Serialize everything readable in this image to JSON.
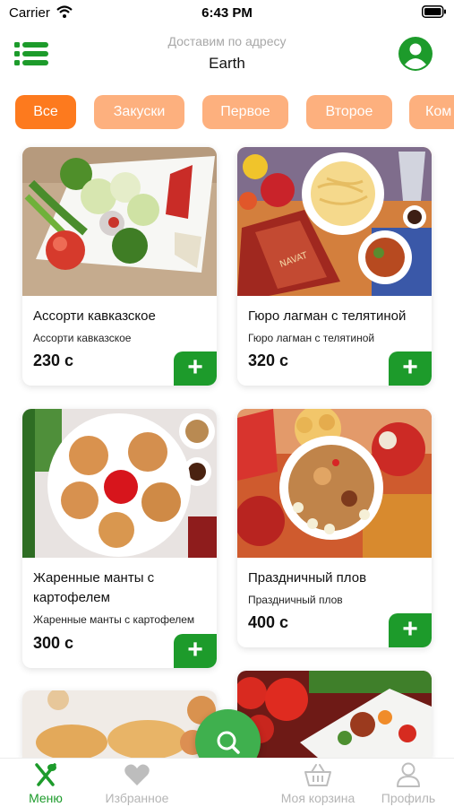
{
  "status_bar": {
    "carrier": "Carrier",
    "time": "6:43 PM"
  },
  "header": {
    "subtitle": "Доставим по адресу",
    "address": "Earth"
  },
  "categories": [
    {
      "label": "Все",
      "active": true
    },
    {
      "label": "Закуски",
      "active": false
    },
    {
      "label": "Первое",
      "active": false
    },
    {
      "label": "Второе",
      "active": false
    },
    {
      "label": "Ком",
      "active": false
    }
  ],
  "products": [
    {
      "title": "Ассорти кавказское",
      "description": "Ассорти кавказское",
      "price": "230 с",
      "add_label": "+"
    },
    {
      "title": "Гюро лагман с телятиной",
      "description": "Гюро лагман с телятиной",
      "price": "320 с",
      "add_label": "+"
    },
    {
      "title": "Жаренные манты с картофелем",
      "description": "Жаренные манты с картофелем",
      "price": "300 с",
      "add_label": "+"
    },
    {
      "title": "Праздничный плов",
      "description": "Праздничный плов",
      "price": "400 с",
      "add_label": "+"
    }
  ],
  "image_labels": {
    "navat": "NAVAT"
  },
  "tabbar": {
    "menu": "Меню",
    "favorites": "Избранное",
    "cart": "Моя корзина",
    "profile": "Профиль"
  },
  "icons": {
    "menu": "list-icon",
    "profile": "user-circle-icon",
    "search": "search-icon",
    "tab_menu": "fork-knife-icon",
    "tab_favorites": "heart-icon",
    "tab_cart": "basket-icon",
    "tab_profile": "person-icon"
  },
  "colors": {
    "brand_green": "#1d9b2b",
    "accent_orange": "#fd7a1e",
    "chip_inactive": "#fdb07e"
  }
}
